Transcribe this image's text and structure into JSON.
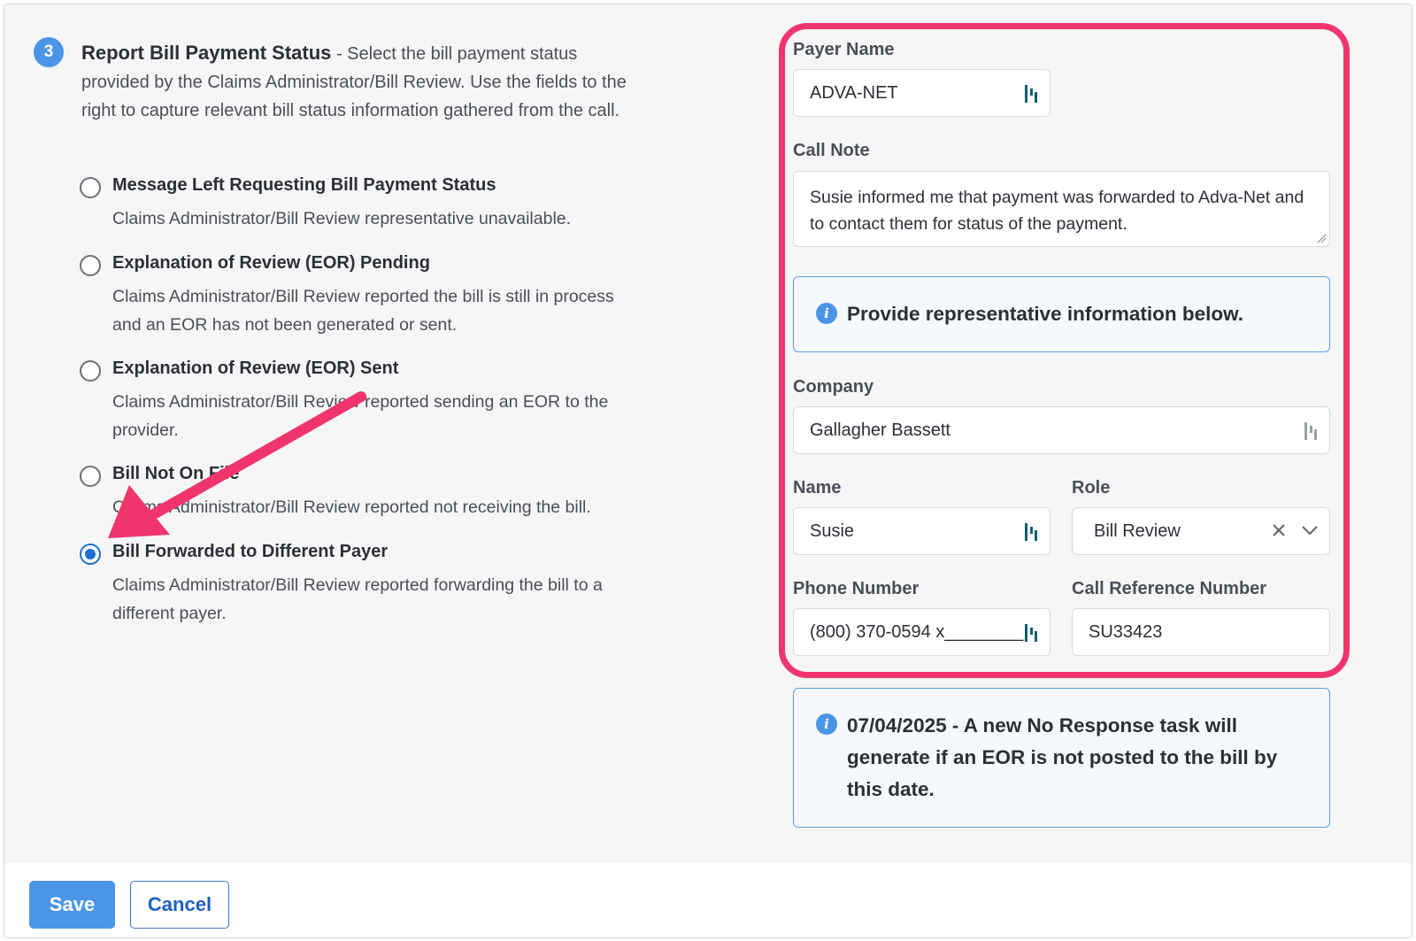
{
  "step": {
    "number": "3",
    "title": "Report Bill Payment Status",
    "description": " - Select the bill payment status provided by the Claims Administrator/Bill Review. Use the fields to the right to capture relevant bill status information gathered from the call."
  },
  "options": [
    {
      "label": "Message Left Requesting Bill Payment Status",
      "description": "Claims Administrator/Bill Review representative unavailable.",
      "checked": false
    },
    {
      "label": "Explanation of Review (EOR) Pending",
      "description": "Claims Administrator/Bill Review reported the bill is still in process and an EOR has not been generated or sent.",
      "checked": false
    },
    {
      "label": "Explanation of Review (EOR) Sent",
      "description": "Claims Administrator/Bill Review reported sending an EOR to the provider.",
      "checked": false
    },
    {
      "label": "Bill Not On File",
      "description": "Claims Administrator/Bill Review reported not receiving the bill.",
      "checked": false
    },
    {
      "label": "Bill Forwarded to Different Payer",
      "description": "Claims Administrator/Bill Review reported forwarding the bill to a different payer.",
      "checked": true
    }
  ],
  "form": {
    "payer_name_label": "Payer Name",
    "payer_name_value": "ADVA-NET",
    "call_note_label": "Call Note",
    "call_note_value": "Susie informed me that payment was forwarded to Adva-Net and to contact them for status of the payment.",
    "rep_info_message": "Provide representative information below.",
    "company_label": "Company",
    "company_value": "Gallagher Bassett",
    "name_label": "Name",
    "name_value": "Susie",
    "role_label": "Role",
    "role_value": "Bill Review",
    "phone_label": "Phone Number",
    "phone_value": "(800) 370-0594 x________",
    "call_ref_label": "Call Reference Number",
    "call_ref_value": "SU33423"
  },
  "notice": {
    "date": "07/04/2025",
    "message": " - A new No Response task will generate if an EOR is not posted to the bill by this date."
  },
  "actions": {
    "save_label": "Save",
    "cancel_label": "Cancel"
  },
  "colors": {
    "accent": "#4b95e6",
    "highlight": "#f0356e",
    "link": "#1f5fbf"
  }
}
